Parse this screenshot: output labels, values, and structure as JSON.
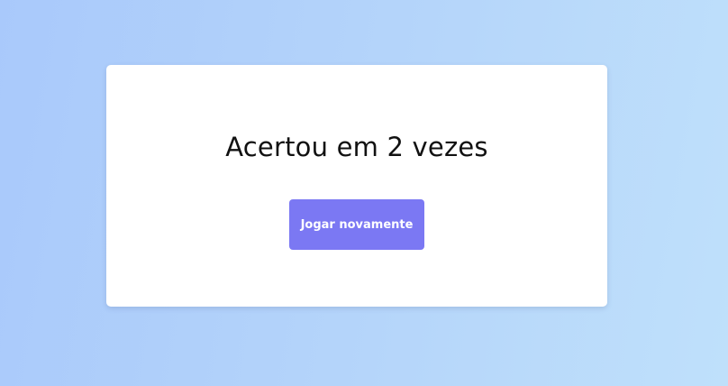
{
  "colors": {
    "background_start": "#a9c9fb",
    "background_end": "#bfe0fb",
    "card": "#ffffff",
    "button": "#7b78f3",
    "button_text": "#ffffff",
    "text": "#111111"
  },
  "result": {
    "message": "Acertou em 2 vezes"
  },
  "actions": {
    "play_again_label": "Jogar novamente"
  }
}
